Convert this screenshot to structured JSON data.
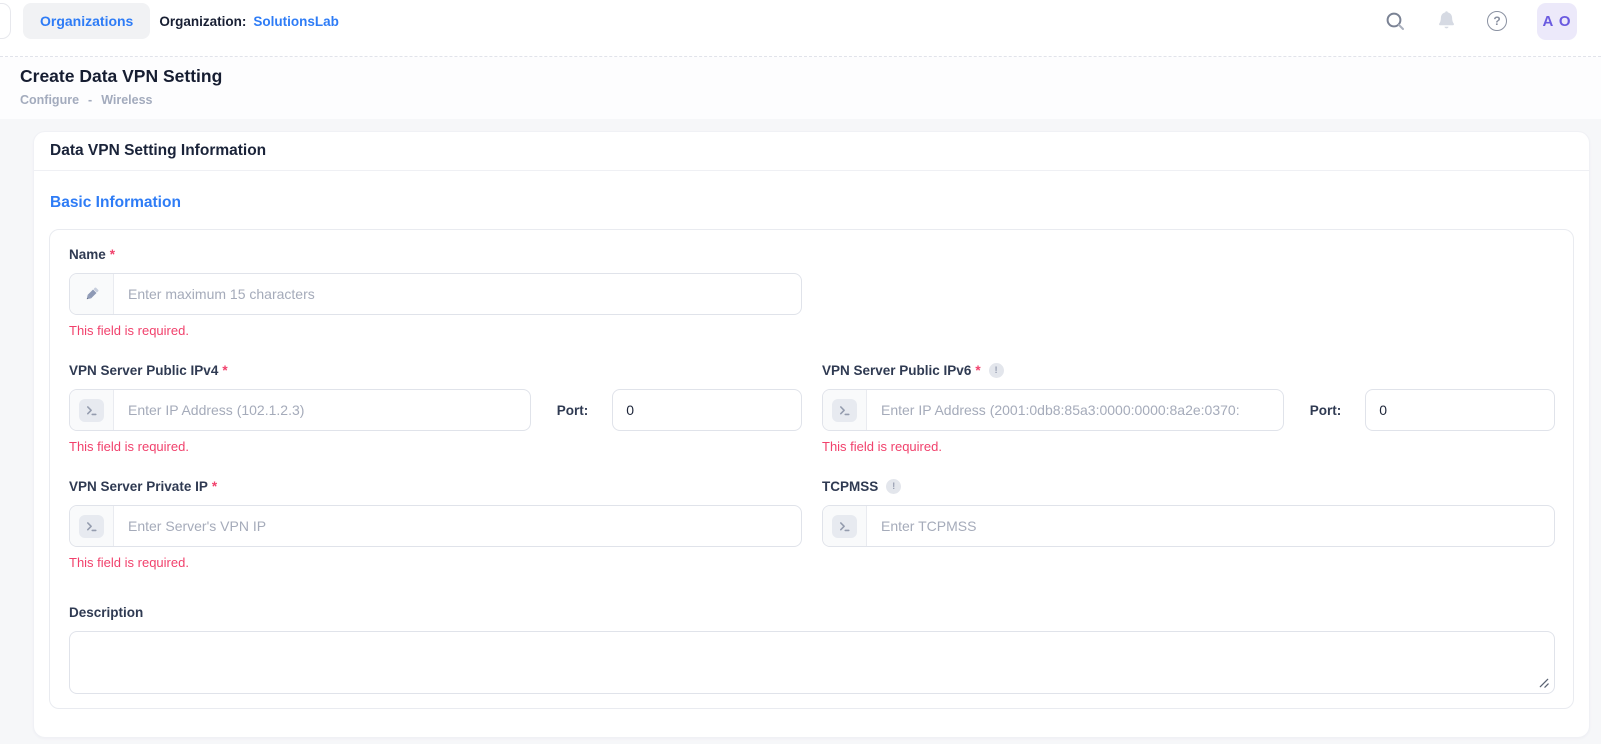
{
  "topbar": {
    "organizations_tab": "Organizations",
    "organization_label": "Organization:",
    "organization_value": "SolutionsLab",
    "avatar_initials": "A O"
  },
  "icons": {
    "help_glyph": "?",
    "info_glyph": "!"
  },
  "header": {
    "title": "Create Data VPN Setting",
    "breadcrumb": {
      "items": [
        "Configure",
        "Wireless"
      ],
      "separator": "-"
    }
  },
  "card": {
    "title": "Data VPN Setting Information",
    "section_title": "Basic Information"
  },
  "form": {
    "required_mark": "*",
    "required_error": "This field is required.",
    "fields": {
      "name": {
        "label": "Name",
        "placeholder": "Enter maximum 15 characters"
      },
      "ipv4": {
        "label": "VPN Server Public IPv4",
        "placeholder": "Enter IP Address (102.1.2.3)",
        "port_label": "Port:",
        "port_value": "0"
      },
      "ipv6": {
        "label": "VPN Server Public IPv6",
        "placeholder": "Enter IP Address (2001:0db8:85a3:0000:0000:8a2e:0370:",
        "port_label": "Port:",
        "port_value": "0"
      },
      "private_ip": {
        "label": "VPN Server Private IP",
        "placeholder": "Enter Server's VPN IP"
      },
      "tcpmss": {
        "label": "TCPMSS",
        "placeholder": "Enter TCPMSS"
      },
      "description": {
        "label": "Description"
      }
    }
  },
  "colors": {
    "primary": "#2e7cf6",
    "danger": "#f1416c",
    "avatar_purple": "#6a5ae0"
  }
}
